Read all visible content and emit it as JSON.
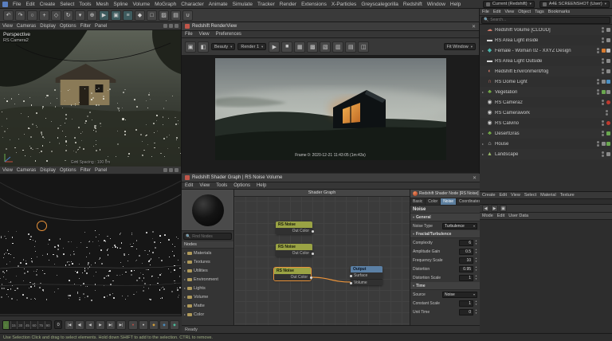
{
  "colors": {
    "accent_orange": "#e8923a",
    "accent_blue": "#6e9cc4",
    "node_noise_header": "#9aa344",
    "node_output_header": "#5b80a5",
    "status_green": "#9fae83"
  },
  "menubar": {
    "items": [
      "File",
      "Edit",
      "Create",
      "Select",
      "Tools",
      "Mesh",
      "Spline",
      "Volume",
      "MoGraph",
      "Character",
      "Animate",
      "Simulate",
      "Tracker",
      "Render",
      "Extensions",
      "X-Particles",
      "Greyscalegorilla",
      "Redshift",
      "Window",
      "Help"
    ],
    "workspace_value": "Current (Redshift)",
    "layout_value": "A4E SCREENSHOT (User)"
  },
  "main_toolbar": {
    "icons": [
      {
        "name": "undo-icon",
        "glyph": "↶"
      },
      {
        "name": "redo-icon",
        "glyph": "↷"
      },
      {
        "name": "live-selection-icon",
        "glyph": "○"
      },
      {
        "name": "move-tool-icon",
        "glyph": "+"
      },
      {
        "name": "scale-tool-icon",
        "glyph": "◇"
      },
      {
        "name": "rotate-tool-icon",
        "glyph": "↻"
      },
      {
        "name": "last-used-tool-icon",
        "glyph": "▾"
      },
      {
        "name": "coordinate-system-icon",
        "glyph": "⊕"
      },
      {
        "name": "render-view-button",
        "glyph": "▶",
        "color": "#3e5b5e"
      },
      {
        "name": "render-picture-viewer-button",
        "glyph": "▣",
        "color": "#3e5b5e"
      },
      {
        "name": "render-settings-button",
        "glyph": "≡",
        "color": "#3e5b5e"
      },
      {
        "name": "scene-nodes-icon",
        "glyph": "◆"
      },
      {
        "name": "model-mode-icon",
        "glyph": "□"
      },
      {
        "name": "texture-mode-icon",
        "glyph": "▨"
      },
      {
        "name": "workplane-mode-icon",
        "glyph": "▤"
      },
      {
        "name": "snap-settings-icon",
        "glyph": "∪"
      }
    ]
  },
  "viewport_top": {
    "menus": [
      "View",
      "Cameras",
      "Display",
      "Options",
      "Filter",
      "Panel"
    ],
    "view_label": "Perspective",
    "camera_label": "RS Camera2",
    "grid_label": "Grid Spacing : 100 cm"
  },
  "viewport_bottom": {
    "menus": [
      "View",
      "Cameras",
      "Display",
      "Options",
      "Filter",
      "Panel"
    ]
  },
  "timeline": {
    "ticks": [
      "0",
      "15",
      "30",
      "45",
      "60",
      "75",
      "90"
    ],
    "current_frame": "0",
    "transport": [
      {
        "name": "goto-start-button",
        "glyph": "|◀"
      },
      {
        "name": "previous-key-button",
        "glyph": "◀|"
      },
      {
        "name": "previous-frame-button",
        "glyph": "◀"
      },
      {
        "name": "play-button",
        "glyph": "▶"
      },
      {
        "name": "next-frame-button",
        "glyph": "▶|"
      },
      {
        "name": "goto-end-button",
        "glyph": "▶|"
      }
    ],
    "record": [
      {
        "name": "record-keyframe-button",
        "glyph": "●",
        "color": "#c05046"
      },
      {
        "name": "autokey-button",
        "glyph": "●",
        "color": "#c8c8c8"
      },
      {
        "name": "record-position-button",
        "glyph": "◆",
        "color": "#d8a23a"
      },
      {
        "name": "record-scale-button",
        "glyph": "◆",
        "color": "#4a90c4"
      },
      {
        "name": "record-rotation-button",
        "glyph": "◆",
        "color": "#4ac4a0"
      }
    ]
  },
  "renderview": {
    "title": "Redshift RenderView",
    "menus": [
      "File",
      "View",
      "Preferences"
    ],
    "toolbar": {
      "left_icons": [
        {
          "name": "snapshot-icon",
          "glyph": "▣"
        },
        {
          "name": "ab-compare-icon",
          "glyph": "◧"
        }
      ],
      "aov_value": "Beauty",
      "render_value": "Render 1",
      "cluster_icons": [
        {
          "name": "start-render-icon",
          "glyph": "▶"
        },
        {
          "name": "stop-render-icon",
          "glyph": "■"
        },
        {
          "name": "region-render-icon",
          "glyph": "▦"
        },
        {
          "name": "progressive-render-icon",
          "glyph": "▩"
        },
        {
          "name": "aov-toggle-icon",
          "glyph": "▧"
        },
        {
          "name": "snapshot-store-icon",
          "glyph": "▥"
        },
        {
          "name": "snapshot-grid-icon",
          "glyph": "▤"
        },
        {
          "name": "split-view-icon",
          "glyph": "◫"
        }
      ],
      "zoom_value": "Fit Window"
    },
    "status": "Frame 0:  2020-12-21  11:43:05  (1m:43s)"
  },
  "shadergraph": {
    "title": "Redshift Shader Graph | RS Noise Volume",
    "menus": [
      "Edit",
      "View",
      "Tools",
      "Options",
      "Help"
    ],
    "canvas_title": "Shader Graph",
    "search_placeholder": "Find Nodes",
    "nodes_header": "Nodes",
    "categories": [
      "Materials",
      "Textures",
      "Utilities",
      "Environment",
      "Lights",
      "Volume",
      "Matte",
      "Color"
    ],
    "nodes": [
      {
        "title": "RS Noise",
        "port": "Out Color"
      },
      {
        "title": "RS Noise",
        "port": "Out Color"
      },
      {
        "title": "RS Noise",
        "port": "Out Color"
      }
    ],
    "output_node": {
      "title": "Output",
      "ports": [
        "Surface",
        "Volume"
      ]
    },
    "status": "Ready"
  },
  "node_inspector": {
    "title": "Redshift Shader Node [RS Noise]",
    "tabs": [
      {
        "label": "Basic"
      },
      {
        "label": "Color"
      },
      {
        "label": "Noise",
        "active": true
      },
      {
        "label": "Coordinates"
      }
    ],
    "section_label": "Noise",
    "rows": [
      {
        "type": "group",
        "label": "General"
      },
      {
        "type": "dropdown",
        "label": "Noise Type",
        "value": "Turbulence"
      },
      {
        "type": "group",
        "label": "Fractal/Turbulence"
      },
      {
        "type": "number",
        "label": "Complexity",
        "value": "6"
      },
      {
        "type": "number",
        "label": "Amplitude Gain",
        "value": "0.5"
      },
      {
        "type": "number",
        "label": "Frequency Scale",
        "value": "10"
      },
      {
        "type": "number",
        "label": "Distortion",
        "value": "0.95"
      },
      {
        "type": "number",
        "label": "Distortion Scale",
        "value": "1"
      },
      {
        "type": "group",
        "label": "Time"
      },
      {
        "type": "dropdown",
        "label": "Source",
        "value": "Noise"
      },
      {
        "type": "number",
        "label": "Constant Scale",
        "value": "1"
      },
      {
        "type": "number",
        "label": "Unit Time",
        "value": "0"
      }
    ]
  },
  "object_manager": {
    "menus": [
      "File",
      "Edit",
      "View",
      "Object",
      "Tags",
      "Bookmarks"
    ],
    "search_placeholder": "Search...",
    "objects": [
      {
        "name": "Redshift Volume [CLOUD]",
        "icon": "cloud-volume-icon",
        "glyph": "☁",
        "color": "#cf7a6a",
        "tags": [
          "#8a8a8a"
        ]
      },
      {
        "name": "RS Area Light inside",
        "icon": "area-light-icon",
        "glyph": "▬",
        "color": "#d8d8d8",
        "tags": [
          "#8a8a8a"
        ]
      },
      {
        "name": "Female - Woman 02 - XXYZ Design",
        "icon": "figure-icon",
        "glyph": "◆",
        "color": "#4ab8b0",
        "expand": true,
        "tags": [
          "#d87a2e",
          "#b8b8b8"
        ]
      },
      {
        "name": "RS Area Light Outside",
        "icon": "area-light-icon",
        "glyph": "▬",
        "color": "#d8d8d8",
        "tags": [
          "#8a8a8a"
        ]
      },
      {
        "name": "Redshift Environment/fog",
        "icon": "environment-icon",
        "glyph": "◐",
        "color": "#cf7a6a",
        "tags": [
          "#8a8a8a"
        ]
      },
      {
        "name": "RS Dome Light",
        "icon": "dome-light-icon",
        "glyph": "∩",
        "color": "#cf7a6a",
        "tags": [
          "#8a8a8a",
          "#4a90c4"
        ]
      },
      {
        "name": "Vegetation",
        "icon": "vegetation-icon",
        "glyph": "♣",
        "color": "#7ab648",
        "expand": true,
        "tags": [
          "#6aa84f",
          "#8a8a8a"
        ]
      },
      {
        "name": "RS Camera2",
        "icon": "camera-icon",
        "glyph": "◉",
        "color": "#cfcfcf",
        "badge": "#c03a2e"
      },
      {
        "name": "RS Camerawork",
        "icon": "camera-icon",
        "glyph": "◉",
        "color": "#cfcfcf"
      },
      {
        "name": "RS Calvino",
        "icon": "camera-icon",
        "glyph": "◉",
        "color": "#cfcfcf",
        "badge": "#c03a2e"
      },
      {
        "name": "DesertGras",
        "icon": "grass-icon",
        "glyph": "♣",
        "color": "#7ab648",
        "expand": true,
        "tags": [
          "#6aa84f"
        ]
      },
      {
        "name": "House",
        "icon": "house-icon",
        "glyph": "⌂",
        "color": "#cfcfcf",
        "expand": true,
        "tags": [
          "#8a8a8a",
          "#6aa84f"
        ]
      },
      {
        "name": "Landscape",
        "icon": "landscape-icon",
        "glyph": "▲",
        "color": "#9ab86a",
        "expand": true,
        "tags": [
          "#8a8a8a"
        ]
      }
    ]
  },
  "material_manager": {
    "menus": [
      "Create",
      "Edit",
      "View",
      "Select",
      "Material",
      "Texture"
    ]
  },
  "attribute_manager": {
    "menus": [
      "Mode",
      "Edit",
      "User Data"
    ],
    "icons": [
      {
        "name": "history-back-icon",
        "glyph": "◀"
      },
      {
        "name": "history-forward-icon",
        "glyph": "▶"
      },
      {
        "name": "lock-icon",
        "glyph": "▣"
      }
    ]
  },
  "statusbar": {
    "text": "Use Selection Click and drag to select elements. Hold down SHIFT to add to the selection. CTRL to remove."
  }
}
